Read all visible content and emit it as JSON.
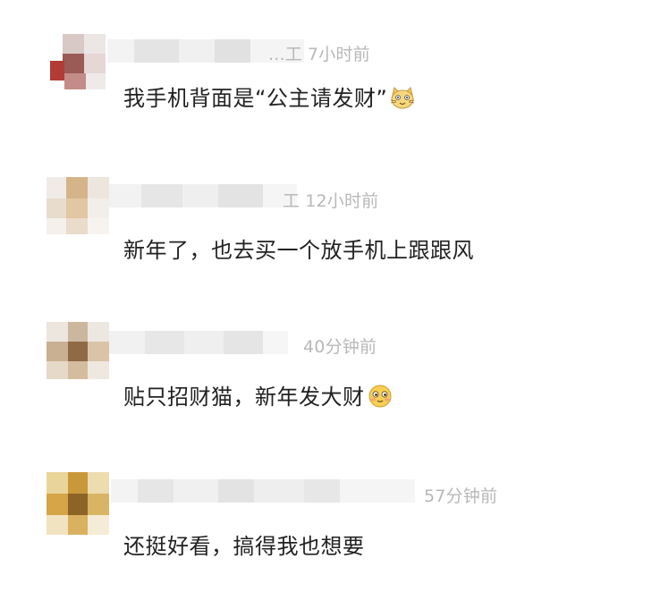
{
  "comments": [
    {
      "name_tail": "...工",
      "time": "7小时前",
      "text": "我手机背面是“公主请发财”",
      "emoji": "cat-face-icon"
    },
    {
      "name_tail": "工",
      "time": "12小时前",
      "text": "新年了，也去买一个放手机上跟跟风",
      "emoji": ""
    },
    {
      "name_tail": "",
      "time": "40分钟前",
      "text": "贴只招财猫，新年发大财",
      "emoji": "shy-smile-face-icon"
    },
    {
      "name_tail": "",
      "time": "57分钟前",
      "text": "还挺好看，搞得我也想要",
      "emoji": ""
    }
  ],
  "colors": {
    "text": "#222222",
    "meta": "#b8b8b8",
    "background": "#ffffff"
  }
}
